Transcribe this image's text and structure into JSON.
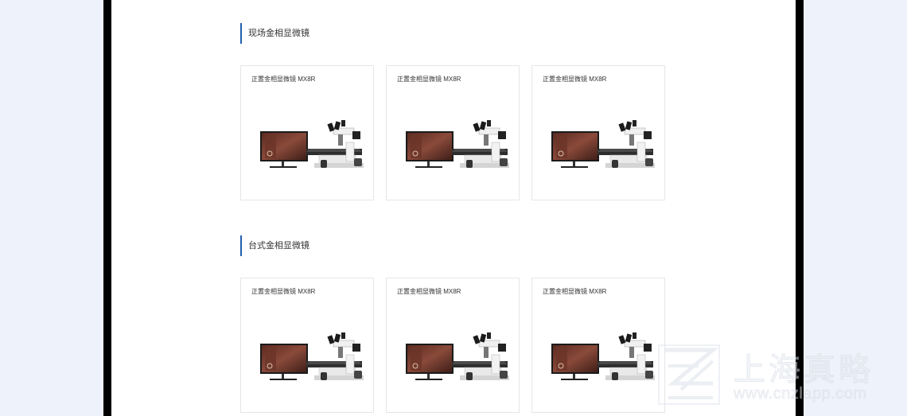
{
  "sections": [
    {
      "title": "现场金相显微镜",
      "products": [
        {
          "name": "正置金相显微镜 MX8R"
        },
        {
          "name": "正置金相显微镜 MX8R"
        },
        {
          "name": "正置金相显微镜 MX8R"
        }
      ]
    },
    {
      "title": "台式金相显微镜",
      "products": [
        {
          "name": "正置金相显微镜 MX8R"
        },
        {
          "name": "正置金相显微镜 MX8R"
        },
        {
          "name": "正置金相显微镜 MX8R"
        }
      ]
    }
  ],
  "watermark": {
    "name": "上海真略",
    "url": "www.cnzlapp.com"
  },
  "colors": {
    "accent": "#1f5fae",
    "page_bg": "#eef2fa"
  },
  "icons": {
    "product_image": "microscope-with-monitor-icon",
    "watermark_logo": "zl-logo-icon"
  }
}
